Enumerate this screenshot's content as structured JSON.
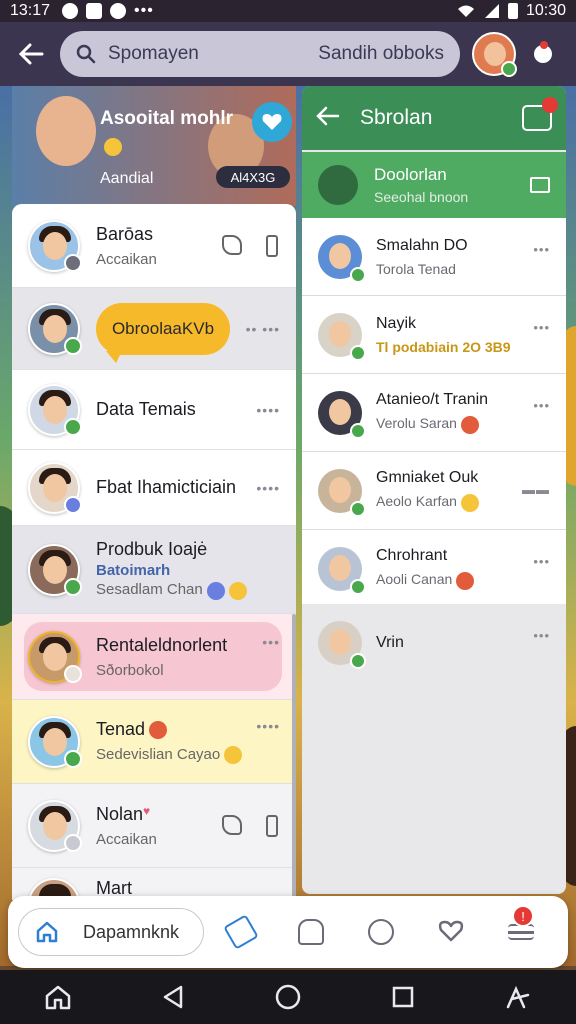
{
  "status_bar": {
    "time": "13:17",
    "clock": "10:30"
  },
  "search": {
    "placeholder": "Spomayen",
    "right_text": "Sandih obboks"
  },
  "hero": {
    "title": "Asooital mohlr",
    "subtitle": "Aandial",
    "pill": "Al4X3G"
  },
  "left_chats": [
    {
      "name": "Barōas",
      "message": "Accaikan"
    },
    {
      "bubble": "ObroolaaKVb"
    },
    {
      "name": "Data Temais"
    },
    {
      "name": "Fbat Ihamicticiain"
    },
    {
      "name": "Prodbuk Ioajė",
      "message2": "Batoimarh",
      "message": "Sesadlam Chan"
    },
    {
      "name": "Rentaleldnorlent",
      "message": "Sðorbokol"
    },
    {
      "name": "Tenad",
      "message": "Sedevislian Cayao"
    },
    {
      "name": "Nolan",
      "message": "Accaikan"
    },
    {
      "name": "Mart"
    }
  ],
  "right_panel": {
    "title": "Sbrolan",
    "group": {
      "name": "Doolorlan",
      "sub": "Seeohal bnoon"
    },
    "chats": [
      {
        "name": "Smalahn DO",
        "message": "Torola Tenad"
      },
      {
        "name": "Nayik",
        "message": "Tl podabiain 2O 3B9"
      },
      {
        "name": "Atanieo/t Tranin",
        "message": "Verolu Saran"
      },
      {
        "name": "Gmniaket Ouk",
        "message": "Aeolo Karfan"
      },
      {
        "name": "Chrohrant",
        "message": "Aooli Canan"
      },
      {
        "name": "Vrin",
        "message": ""
      }
    ]
  },
  "bottom_nav": {
    "home_label": "Dapamnknk",
    "badge": "!"
  },
  "colors": {
    "accent_green": "#3b8f56",
    "accent_blue": "#2f7fd1",
    "badge_red": "#e53935"
  }
}
